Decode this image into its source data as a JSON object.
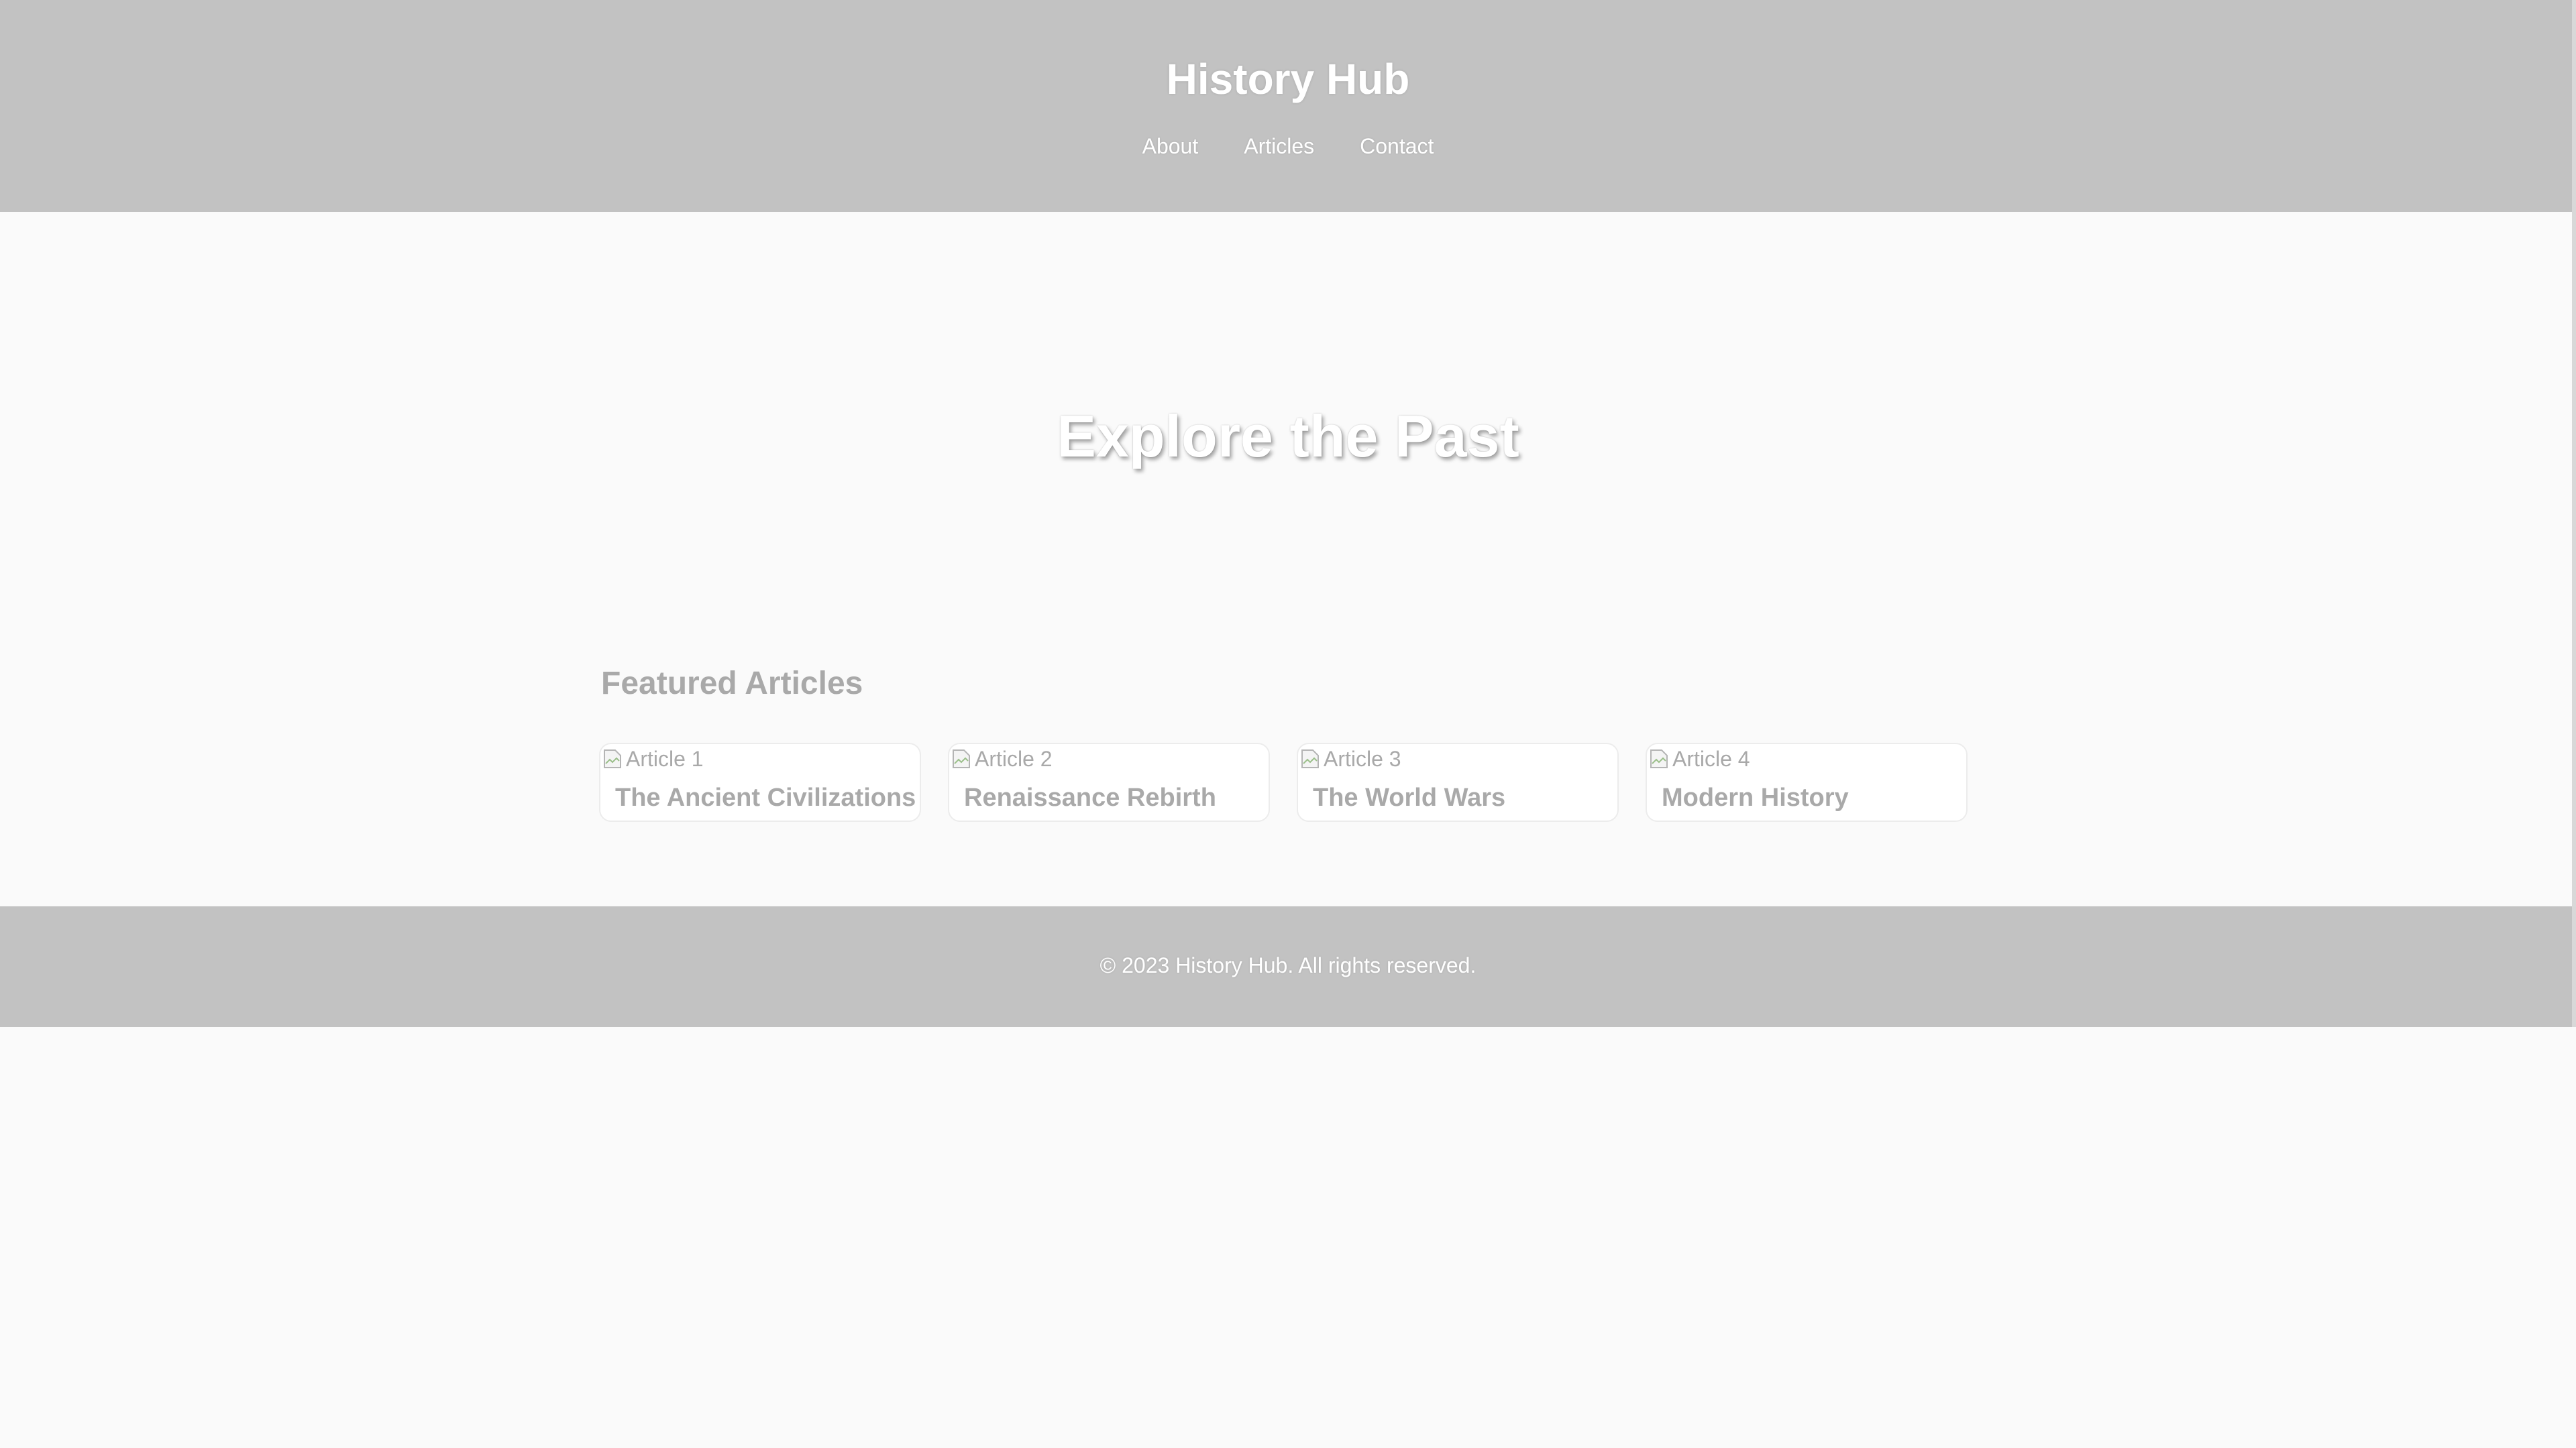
{
  "header": {
    "title": "History Hub",
    "nav": [
      {
        "label": "About"
      },
      {
        "label": "Articles"
      },
      {
        "label": "Contact"
      }
    ]
  },
  "hero": {
    "title": "Explore the Past"
  },
  "featured": {
    "heading": "Featured Articles",
    "articles": [
      {
        "image_alt": "Article 1",
        "title": "The Ancient Civilizations"
      },
      {
        "image_alt": "Article 2",
        "title": "Renaissance Rebirth"
      },
      {
        "image_alt": "Article 3",
        "title": "The World Wars"
      },
      {
        "image_alt": "Article 4",
        "title": "Modern History"
      }
    ]
  },
  "footer": {
    "text": "© 2023 History Hub. All rights reserved."
  },
  "colors": {
    "header_bg": "#c2c2c2",
    "page_bg": "#fafafa",
    "muted_text": "#a9a9a9"
  }
}
